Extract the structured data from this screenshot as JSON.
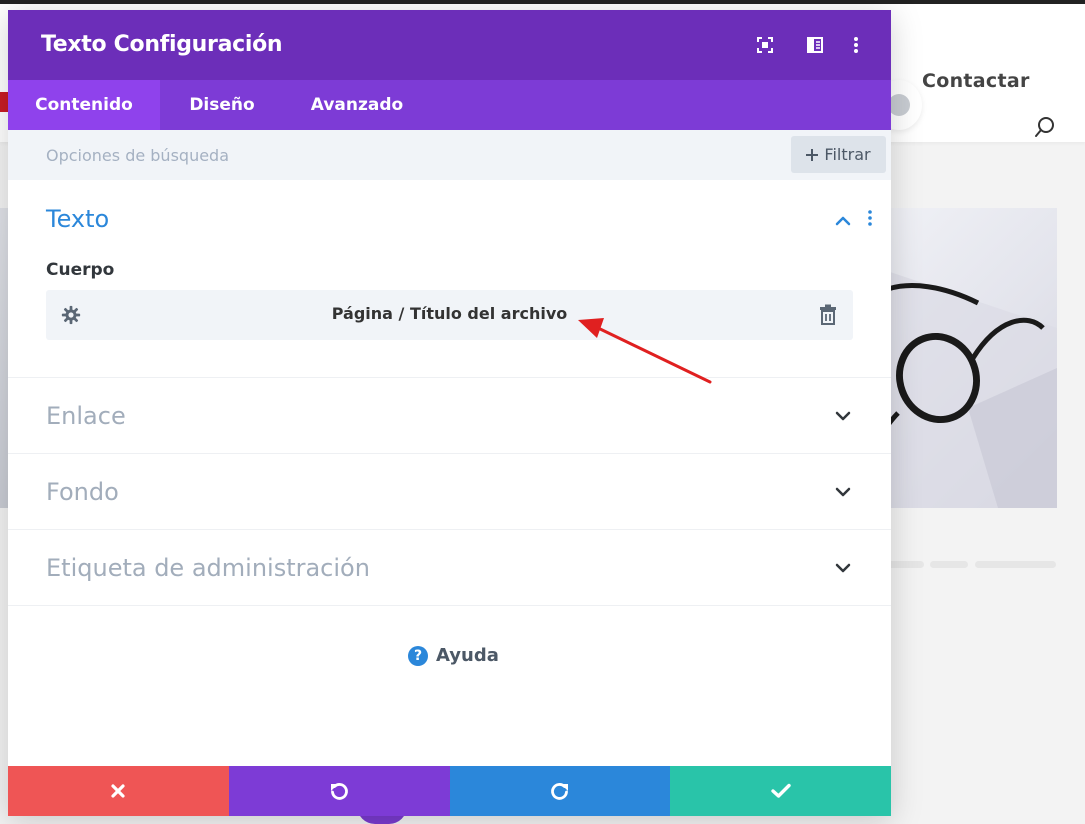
{
  "background": {
    "nav_link": "Contactar",
    "colors": {
      "topbar": "#222222",
      "header": "#ffffff",
      "page": "#f3f3f3"
    }
  },
  "modal": {
    "title": "Texto Configuración",
    "header_icons": [
      "fullscreen-icon",
      "split-view-icon",
      "more-options-icon"
    ],
    "tabs": [
      {
        "label": "Contenido",
        "active": true
      },
      {
        "label": "Diseño",
        "active": false
      },
      {
        "label": "Avanzado",
        "active": false
      }
    ],
    "search": {
      "placeholder": "Opciones de búsqueda",
      "filter_label": "Filtrar"
    },
    "sections": [
      {
        "title": "Texto",
        "expanded": true,
        "field_label": "Cuerpo",
        "dynamic_value": "Página / Título del archivo"
      },
      {
        "title": "Enlace",
        "expanded": false
      },
      {
        "title": "Fondo",
        "expanded": false
      },
      {
        "title": "Etiqueta de administración",
        "expanded": false
      }
    ],
    "help_label": "Ayuda",
    "footer_buttons": [
      "cancel",
      "undo",
      "redo",
      "save"
    ],
    "colors": {
      "header": "#6c2eb9",
      "tabs": "#7d3bd6",
      "active_tab": "#8f42ec",
      "accent_blue": "#2b87da",
      "cancel": "#ef5555",
      "undo": "#7d3bd6",
      "redo": "#2b87da",
      "save": "#29c4a9",
      "annotation_arrow": "#e02020"
    }
  }
}
